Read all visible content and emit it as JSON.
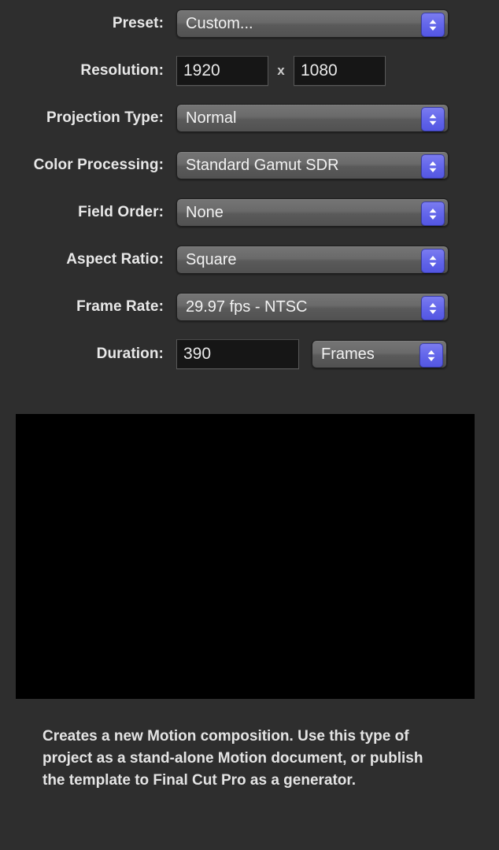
{
  "panel": {
    "background_color": "#2e2e2e",
    "accent_color": "#6366ea"
  },
  "rows": [
    {
      "label": "Preset:",
      "value": "Custom..."
    },
    {
      "label": "Resolution:",
      "width": "1920",
      "separator": "x",
      "height": "1080"
    },
    {
      "label": "Projection Type:",
      "value": "Normal"
    },
    {
      "label": "Color Processing:",
      "value": "Standard Gamut SDR"
    },
    {
      "label": "Field Order:",
      "value": "None"
    },
    {
      "label": "Aspect Ratio:",
      "value": "Square"
    },
    {
      "label": "Frame Rate:",
      "value": "29.97 fps - NTSC"
    },
    {
      "label": "Duration:",
      "value": "390",
      "unit": "Frames"
    }
  ],
  "preview": {
    "name": "preview-thumbnail",
    "color": "#000000"
  },
  "description": {
    "text": "Creates a new Motion composition. Use this type of project as a stand-alone Motion document, or publish the template to Final Cut Pro as a generator."
  }
}
